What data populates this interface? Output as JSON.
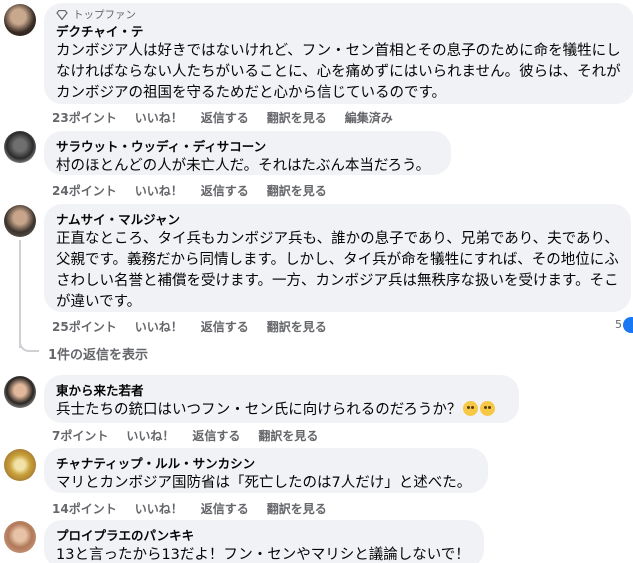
{
  "comments": [
    {
      "badge": "トップファン",
      "author": "デクチャイ・テ",
      "text": "カンボジア人は好きではないけれど、フン・セン首相とその息子のために命を犠牲にしなければならない人たちがいることに、心を痛めずにはいられません。彼らは、それがカンボジアの祖国を守るためだと心から信じているのです。",
      "actions": [
        "23ポイント",
        "いいね！",
        "返信する",
        "翻訳を見る",
        "編集済み"
      ]
    },
    {
      "author": "サラウット・ウッディ・ディサコーン",
      "text": "村のほとんどの人が未亡人だ。それはたぶん本当だろう。",
      "actions": [
        "24ポイント",
        "いいね！",
        "返信する",
        "翻訳を見る"
      ]
    },
    {
      "author": "ナムサイ・マルジャン",
      "text": "正直なところ、タイ兵もカンボジア兵も、誰かの息子であり、兄弟であり、夫であり、父親です。義務だから同情します。しかし、タイ兵が命を犠牲にすれば、その地位にふさわしい名誉と補償を受けます。一方、カンボジア兵は無秩序な扱いを受けます。そこが違いです。",
      "actions": [
        "25ポイント",
        "いいね！",
        "返信する",
        "翻訳を見る"
      ],
      "reaction_count": "5",
      "replies_link": "1件の返信を表示"
    },
    {
      "author": "東から来た若者",
      "text": "兵士たちの銃口はいつフン・セン氏に向けられるのだろうか？",
      "actions": [
        "7ポイント",
        "いいね！",
        "返信する",
        "翻訳を見る"
      ]
    },
    {
      "author": "チャナティップ・ルル・サンカシン",
      "text": "マリとカンボジア国防省は「死亡したのは7人だけ」と述べた。",
      "actions": [
        "14ポイント",
        "いいね！",
        "返信する",
        "翻訳を見る"
      ]
    },
    {
      "author": "プロイプラエのパンキキ",
      "text": "13と言ったから13だよ！フン・センやマリシと議論しないで！"
    }
  ],
  "colors": {
    "bubble": "#f0f2f5",
    "secondary_text": "#65676b",
    "accent": "#1877f2"
  },
  "icons": {
    "badge": "diamond-icon",
    "emoji": "teary-face-emoji-icon"
  }
}
